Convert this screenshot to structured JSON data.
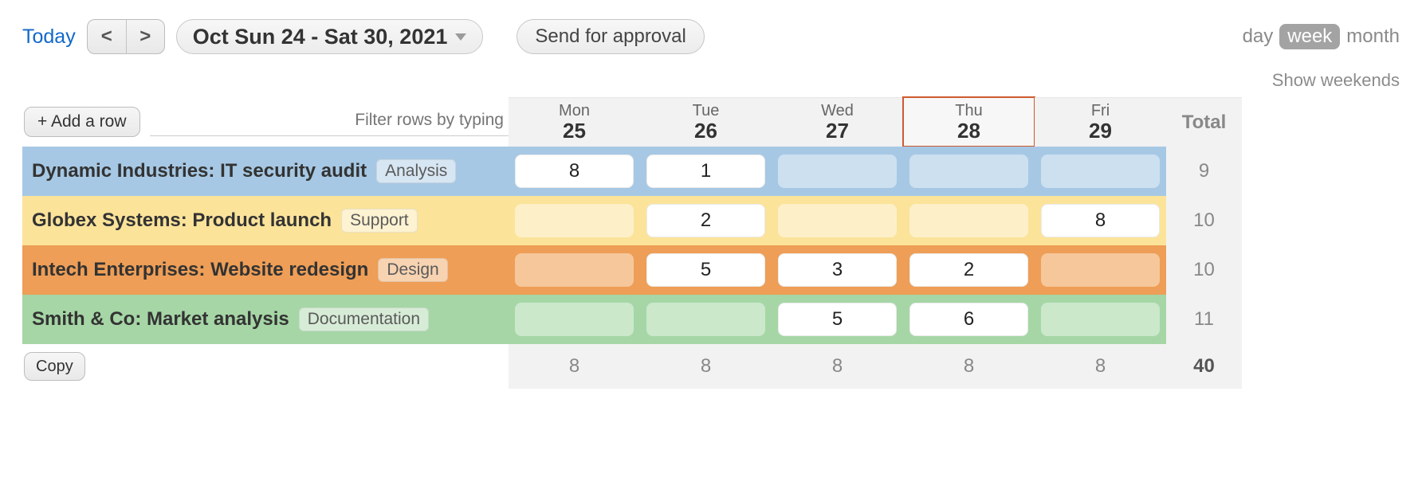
{
  "toolbar": {
    "today_label": "Today",
    "prev_label": "<",
    "next_label": ">",
    "date_range": "Oct Sun 24 - Sat 30, 2021",
    "send_approval": "Send for approval",
    "view_day": "day",
    "view_week": "week",
    "view_month": "month",
    "show_weekends": "Show weekends"
  },
  "controls": {
    "add_row": "+ Add a row",
    "filter_placeholder": "Filter rows by typing",
    "copy": "Copy",
    "total_label": "Total"
  },
  "days": [
    {
      "abbr": "Mon",
      "num": "25",
      "today": false
    },
    {
      "abbr": "Tue",
      "num": "26",
      "today": false
    },
    {
      "abbr": "Wed",
      "num": "27",
      "today": false
    },
    {
      "abbr": "Thu",
      "num": "28",
      "today": true
    },
    {
      "abbr": "Fri",
      "num": "29",
      "today": false
    }
  ],
  "rows": [
    {
      "color": "blue",
      "project": "Dynamic Industries: IT security audit",
      "tag": "Analysis",
      "cells": [
        "8",
        "1",
        "",
        "",
        ""
      ],
      "total": "9"
    },
    {
      "color": "yellow",
      "project": "Globex Systems: Product launch",
      "tag": "Support",
      "cells": [
        "",
        "2",
        "",
        "",
        "8"
      ],
      "total": "10"
    },
    {
      "color": "orange",
      "project": "Intech Enterprises: Website redesign",
      "tag": "Design",
      "cells": [
        "",
        "5",
        "3",
        "2",
        ""
      ],
      "total": "10"
    },
    {
      "color": "green",
      "project": "Smith & Co: Market analysis",
      "tag": "Documentation",
      "cells": [
        "",
        "",
        "5",
        "6",
        ""
      ],
      "total": "11"
    }
  ],
  "column_totals": [
    "8",
    "8",
    "8",
    "8",
    "8"
  ],
  "grand_total": "40"
}
